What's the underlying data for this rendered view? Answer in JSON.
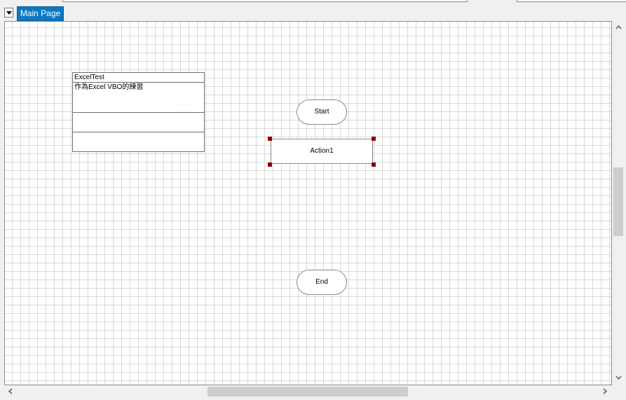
{
  "tabs": [
    {
      "label": "Main Page",
      "active": true
    }
  ],
  "info_box": {
    "title": "ExcelTest",
    "description": "作為Excel VBO的練習"
  },
  "diagram": {
    "start_label": "Start",
    "action_label": "Action1",
    "end_label": "End"
  },
  "icons": {
    "tab_dropdown": "chevron-down-icon",
    "scroll_up": "chevron-up-icon",
    "scroll_down": "chevron-down-icon",
    "scroll_left": "chevron-left-icon",
    "scroll_right": "chevron-right-icon"
  },
  "colors": {
    "tab_active": "#0c78c3",
    "selection_handle": "#8b0000",
    "grid_line": "#d9d9d9"
  }
}
